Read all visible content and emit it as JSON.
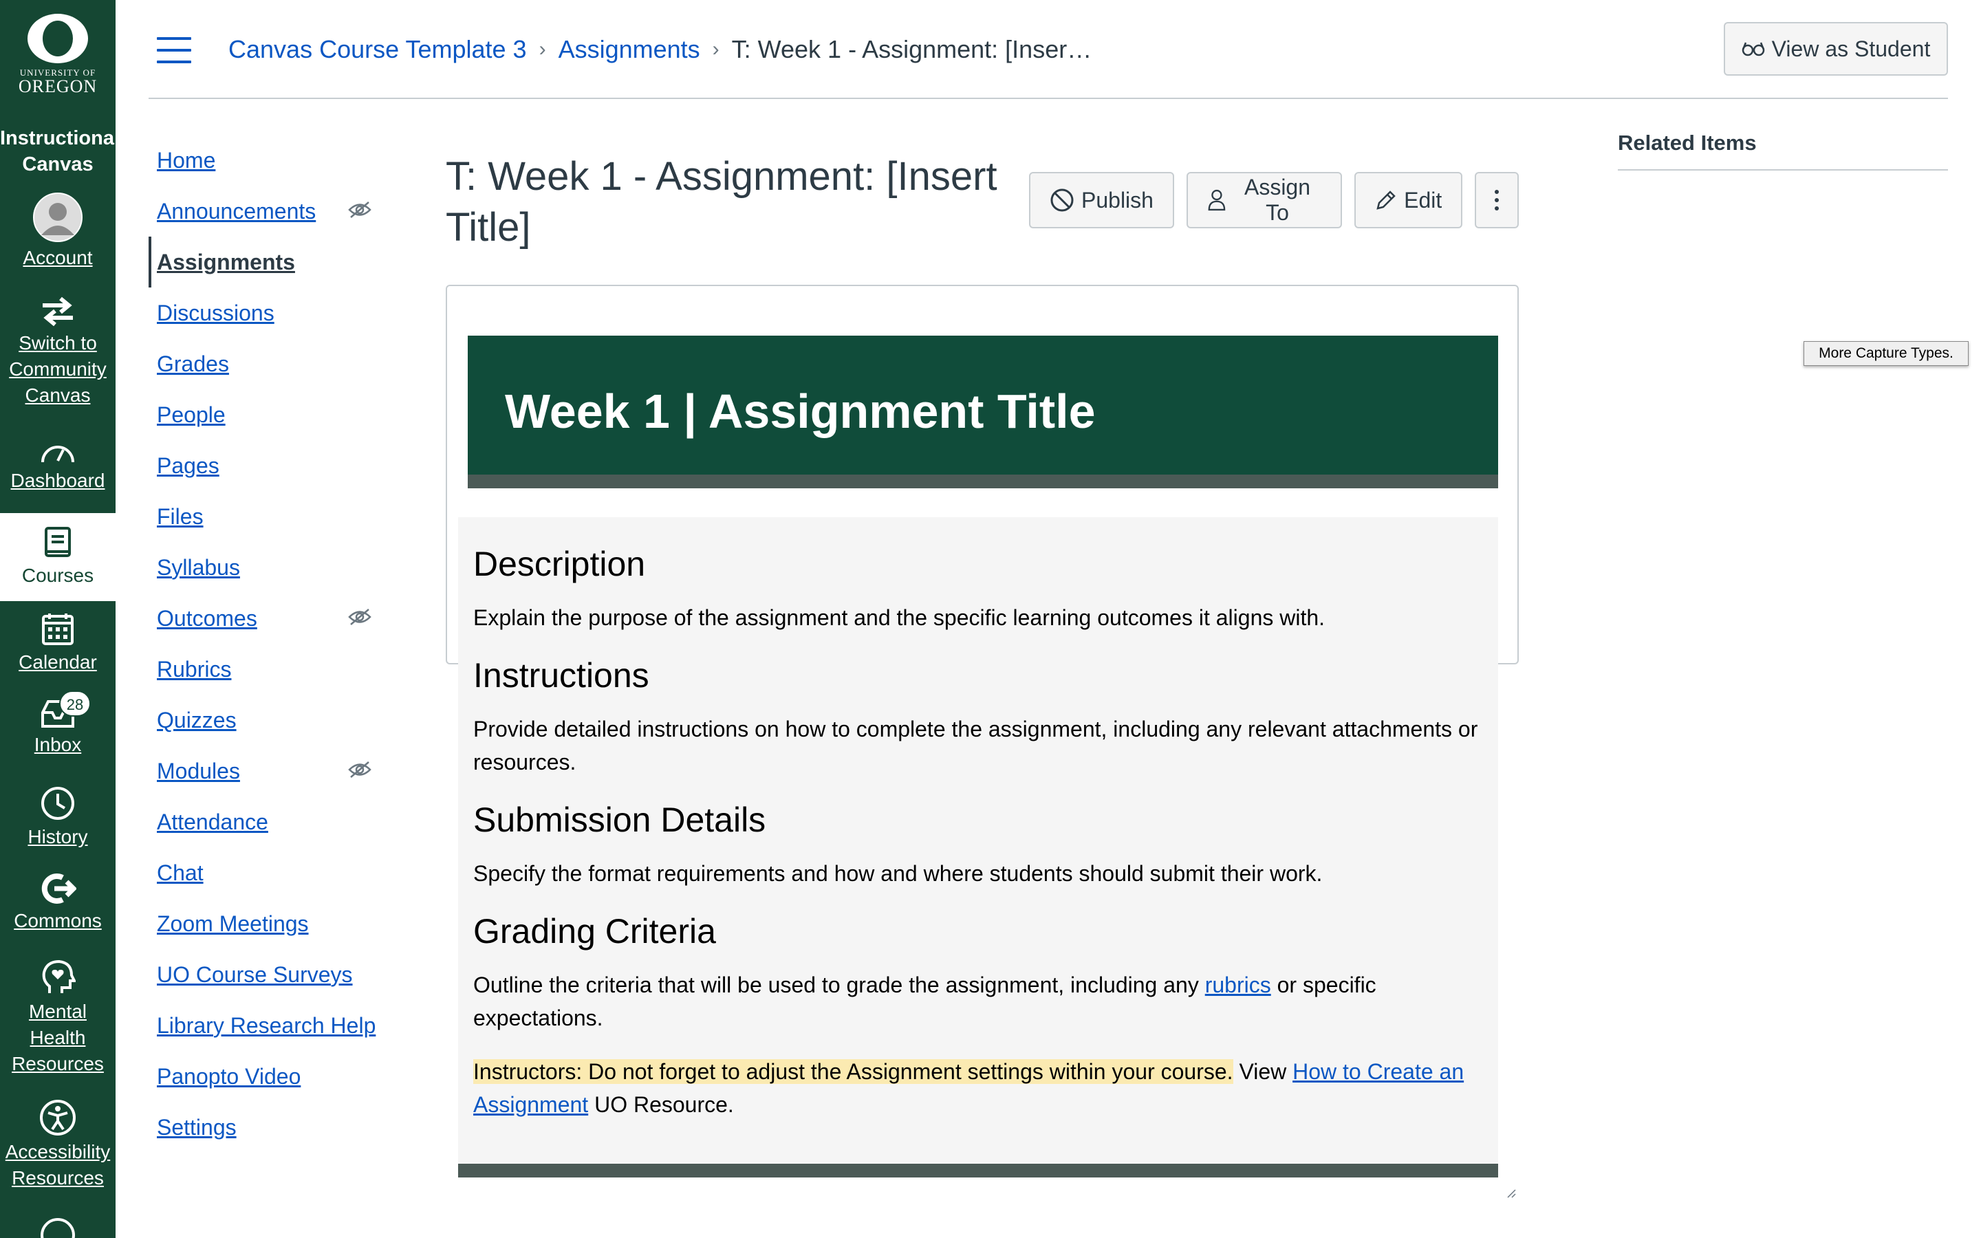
{
  "global_nav": {
    "logo_line1": "UNIVERSITY OF",
    "logo_line2": "OREGON",
    "title": "Instructional Canvas",
    "items": [
      {
        "label": "Account",
        "icon": "account-avatar-icon"
      },
      {
        "label": "Switch to Community Canvas",
        "icon": "switch-arrows-icon"
      },
      {
        "label": "Dashboard",
        "icon": "dashboard-gauge-icon"
      },
      {
        "label": "Courses",
        "icon": "courses-book-icon",
        "active": true
      },
      {
        "label": "Calendar",
        "icon": "calendar-icon"
      },
      {
        "label": "Inbox",
        "icon": "inbox-icon",
        "badge": "28"
      },
      {
        "label": "History",
        "icon": "history-clock-icon"
      },
      {
        "label": "Commons",
        "icon": "commons-icon"
      },
      {
        "label": "Mental Health Resources",
        "icon": "mental-health-icon"
      },
      {
        "label": "Accessibility Resources",
        "icon": "accessibility-icon"
      }
    ]
  },
  "breadcrumb": {
    "course": "Canvas Course Template 3",
    "section": "Assignments",
    "current": "T: Week 1 - Assignment: [Inser…"
  },
  "header": {
    "view_as_student": "View as Student"
  },
  "course_nav": {
    "items": [
      {
        "label": "Home"
      },
      {
        "label": "Announcements",
        "hidden": true
      },
      {
        "label": "Assignments",
        "active": true
      },
      {
        "label": "Discussions"
      },
      {
        "label": "Grades"
      },
      {
        "label": "People"
      },
      {
        "label": "Pages"
      },
      {
        "label": "Files"
      },
      {
        "label": "Syllabus"
      },
      {
        "label": "Outcomes",
        "hidden": true
      },
      {
        "label": "Rubrics"
      },
      {
        "label": "Quizzes"
      },
      {
        "label": "Modules",
        "hidden": true
      },
      {
        "label": "Attendance"
      },
      {
        "label": "Chat"
      },
      {
        "label": "Zoom Meetings"
      },
      {
        "label": "UO Course Surveys"
      },
      {
        "label": "Library Research Help"
      },
      {
        "label": "Panopto Video"
      },
      {
        "label": "Settings"
      }
    ]
  },
  "assignment": {
    "title": "T: Week 1 - Assignment: [Insert Title]",
    "actions": {
      "publish": "Publish",
      "assign_to": "Assign To",
      "edit": "Edit"
    },
    "banner_title": "Week 1 | Assignment Title",
    "sections": {
      "description_heading": "Description",
      "description_text": "Explain the purpose of the assignment and the specific learning outcomes it aligns with.",
      "instructions_heading": "Instructions",
      "instructions_text": "Provide detailed instructions on how to complete the assignment, including any relevant attachments or resources.",
      "submission_heading": "Submission Details",
      "submission_text": "Specify the format requirements and how and where students should submit their work.",
      "grading_heading": "Grading Criteria",
      "grading_text_before": "Outline the criteria that will be used to grade the assignment, including any ",
      "grading_link": "rubrics",
      "grading_text_after": " or specific expectations.",
      "note_highlight": "Instructors: Do not forget to adjust the Assignment settings within your course.",
      "note_view": " View ",
      "note_link": "How to Create an Assignment",
      "note_after": " UO Resource."
    }
  },
  "related": {
    "heading": "Related Items"
  },
  "tooltip": {
    "text": "More Capture Types."
  },
  "colors": {
    "brand_green": "#154733",
    "banner_green": "#104c3a",
    "link_blue": "#0b57c3",
    "highlight": "#fbeab1"
  }
}
